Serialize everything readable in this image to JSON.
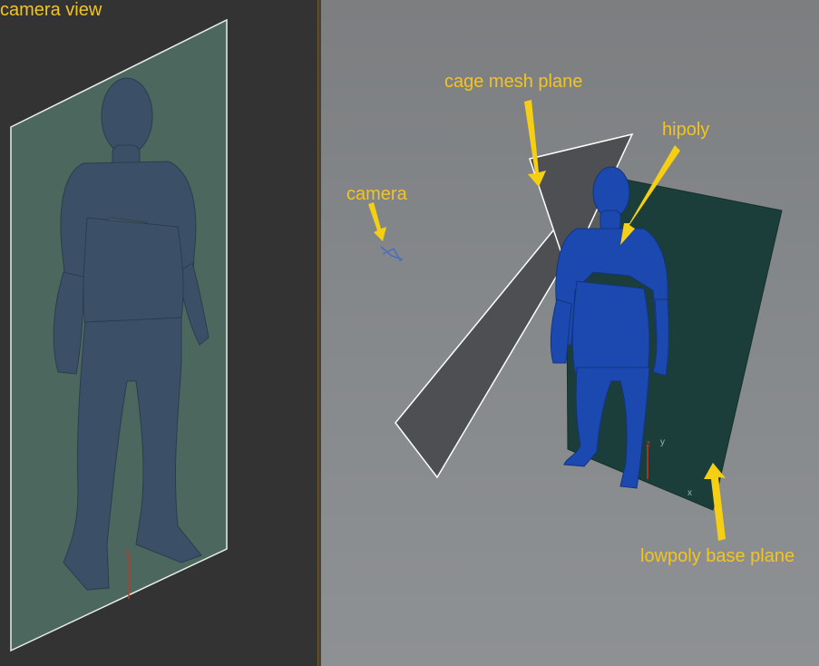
{
  "colors": {
    "label_text": "#f2c422",
    "arrow": "#f5cf14",
    "left_viewport_bg": "#333333",
    "right_viewport_bg": "#85888b",
    "cage_plane_fill": "#4e4f52",
    "cage_plane_outline": "#ffffff",
    "lowpoly_plane_fill": "#1c3e3a",
    "hipoly_figure": "#1c49b0",
    "camera_view_figure": "#3b5067",
    "camera_view_plane": "#557a6e"
  },
  "left_viewport": {
    "label": "camera view",
    "axis_labels": {
      "z": "z"
    }
  },
  "right_viewport": {
    "labels": {
      "cage_mesh_plane": "cage mesh plane",
      "hipoly": "hipoly",
      "camera": "camera",
      "lowpoly_base_plane": "lowpoly base plane"
    },
    "axis_labels": {
      "z": "z",
      "y": "y",
      "x": "x"
    },
    "icons": [
      "camera-icon",
      "arrow-icon"
    ]
  }
}
